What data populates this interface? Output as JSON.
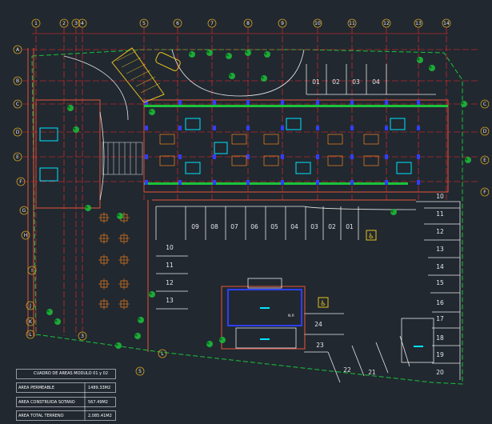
{
  "axes_top": [
    "1",
    "2",
    "3",
    "4",
    "5",
    "6",
    "7",
    "8",
    "9",
    "10",
    "11",
    "12",
    "13",
    "14"
  ],
  "axes_left": [
    "A",
    "B",
    "C",
    "D",
    "E",
    "F",
    "G",
    "H",
    "I",
    "J",
    "K",
    "L"
  ],
  "axes_right": [
    "C",
    "D",
    "E",
    "F"
  ],
  "bottom_markers": [
    "3",
    "L",
    "5"
  ],
  "parking_top": [
    "01",
    "02",
    "03",
    "04"
  ],
  "parking_row": [
    "09",
    "08",
    "07",
    "06",
    "05",
    "04",
    "03",
    "02",
    "01"
  ],
  "parking_left": [
    "10",
    "11",
    "12",
    "13"
  ],
  "parking_right": [
    "10",
    "11",
    "12",
    "13",
    "14",
    "15",
    "16",
    "17",
    "18",
    "19",
    "20"
  ],
  "parking_bottom_right": [
    "24",
    "23",
    "22",
    "21"
  ],
  "level_mark": "N.P.",
  "area_table": {
    "title": "CUADRO DE AREAS MODULO 01 y 02",
    "rows": [
      {
        "label": "AREA PERMEABLE",
        "value": "1489.33M2"
      },
      {
        "label": "AREA CONSTRUIDA SOTANO",
        "value": "567.49M2"
      },
      {
        "label": "AREA TOTAL TERRENO",
        "value": "2,085.41M2"
      }
    ]
  },
  "colors": {
    "background": "#212830",
    "axis": "#d4a020",
    "wall": "#e8553a",
    "green": "#19c43a",
    "blue": "#2f3fff",
    "cyan": "#00e5ff",
    "red": "#ff2a2a",
    "white": "#e8e8e8",
    "tree": "#1db83a",
    "furniture": "#e07a20"
  }
}
